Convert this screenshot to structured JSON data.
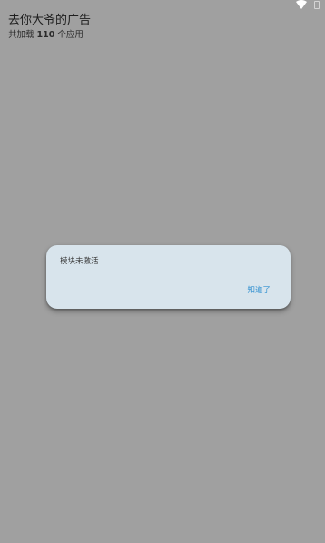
{
  "header": {
    "title": "去你大爷的广告",
    "subtitle_prefix": "共加载 ",
    "subtitle_count": "110",
    "subtitle_suffix": " 个应用"
  },
  "status_bar": {
    "icons": [
      "wifi-icon",
      "battery-icon"
    ]
  },
  "dialog": {
    "message": "模块未激活",
    "confirm_label": "知道了"
  },
  "colors": {
    "background": "#a0a0a0",
    "dialog_background": "#d8e4ec",
    "accent": "#2f8fd0"
  }
}
